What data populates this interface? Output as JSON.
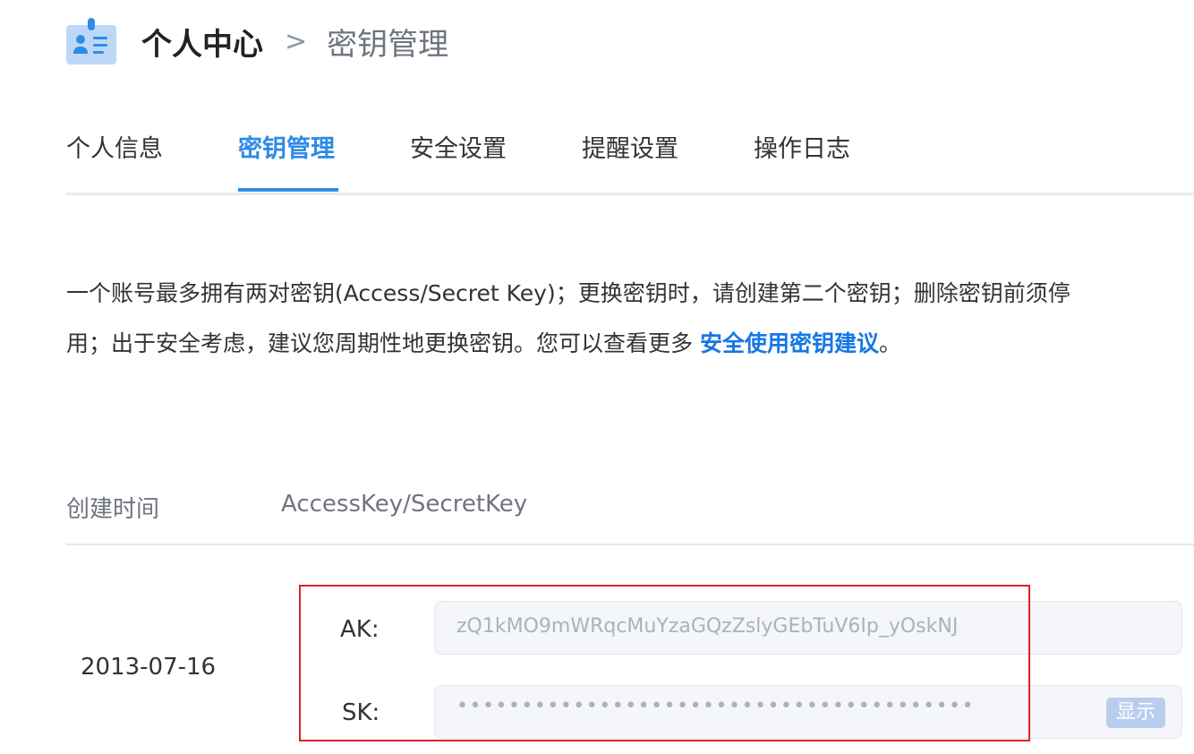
{
  "breadcrumb": {
    "root": "个人中心",
    "separator": ">",
    "current": "密钥管理"
  },
  "tabs": [
    {
      "label": "个人信息",
      "active": false
    },
    {
      "label": "密钥管理",
      "active": true
    },
    {
      "label": "安全设置",
      "active": false
    },
    {
      "label": "提醒设置",
      "active": false
    },
    {
      "label": "操作日志",
      "active": false
    }
  ],
  "description": {
    "line1": "一个账号最多拥有两对密钥(Access/Secret Key)；更换密钥时，请创建第二个密钥；删除密钥前须停",
    "line2_prefix": "用；出于安全考虑，建议您周期性地更换密钥。您可以查看更多 ",
    "link": "安全使用密钥建议",
    "line2_suffix": "。"
  },
  "table": {
    "headers": {
      "created": "创建时间",
      "keys": "AccessKey/SecretKey"
    },
    "rows": [
      {
        "date": "2013-07-16",
        "ak_label": "AK:",
        "ak_value": "zQ1kMO9mWRqcMuYzaGQzZslyGEbTuV6Ip_yOskNJ",
        "sk_label": "SK:",
        "sk_value": "••••••••••••••••••••••••••••••••••••••••",
        "show_button": "显示"
      }
    ]
  },
  "colors": {
    "accent": "#2f8be6",
    "link": "#1677e6",
    "highlight_box": "#d9232f",
    "input_bg": "#f4f6f9",
    "show_button_bg": "#b9cdee"
  },
  "icons": {
    "header": "user-card-icon"
  }
}
